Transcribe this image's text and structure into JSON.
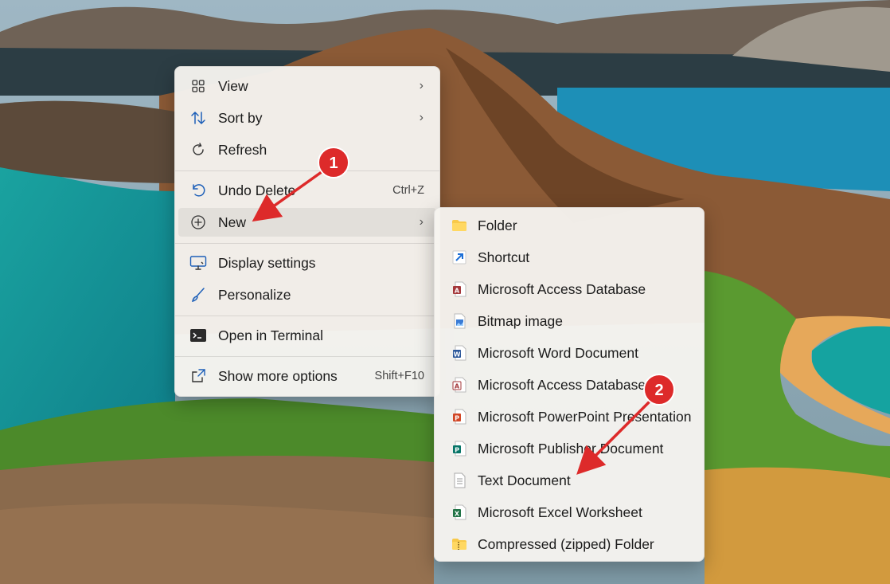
{
  "main_menu": {
    "items": [
      {
        "label": "View",
        "icon": "grid-icon",
        "has_submenu": true
      },
      {
        "label": "Sort by",
        "icon": "sort-arrows-icon",
        "has_submenu": true
      },
      {
        "label": "Refresh",
        "icon": "refresh-icon"
      },
      {
        "label": "Undo Delete",
        "icon": "undo-icon",
        "shortcut": "Ctrl+Z"
      },
      {
        "label": "New",
        "icon": "plus-circle-icon",
        "has_submenu": true
      },
      {
        "label": "Display settings",
        "icon": "monitor-icon"
      },
      {
        "label": "Personalize",
        "icon": "brush-icon"
      },
      {
        "label": "Open in Terminal",
        "icon": "terminal-icon"
      },
      {
        "label": "Show more options",
        "icon": "share-icon",
        "shortcut": "Shift+F10"
      }
    ],
    "chevron": "›"
  },
  "new_submenu": {
    "items": [
      {
        "label": "Folder",
        "icon": "folder-icon"
      },
      {
        "label": "Shortcut",
        "icon": "shortcut-arrow-icon"
      },
      {
        "label": "Microsoft Access Database",
        "icon": "access-icon"
      },
      {
        "label": "Bitmap image",
        "icon": "bitmap-icon"
      },
      {
        "label": "Microsoft Word Document",
        "icon": "word-icon"
      },
      {
        "label": "Microsoft Access Database",
        "icon": "access-icon"
      },
      {
        "label": "Microsoft PowerPoint Presentation",
        "icon": "powerpoint-icon"
      },
      {
        "label": "Microsoft Publisher Document",
        "icon": "publisher-icon"
      },
      {
        "label": "Text Document",
        "icon": "text-document-icon"
      },
      {
        "label": "Microsoft Excel Worksheet",
        "icon": "excel-icon"
      },
      {
        "label": "Compressed (zipped) Folder",
        "icon": "zip-folder-icon"
      }
    ]
  },
  "annotations": [
    {
      "number": "1"
    },
    {
      "number": "2"
    }
  ],
  "colors": {
    "annotation_red": "#dd2a2a",
    "access": "#a4373a",
    "word": "#2b579a",
    "powerpoint": "#d24726",
    "publisher": "#077568",
    "excel": "#217346",
    "folder": "#f8c94a"
  }
}
